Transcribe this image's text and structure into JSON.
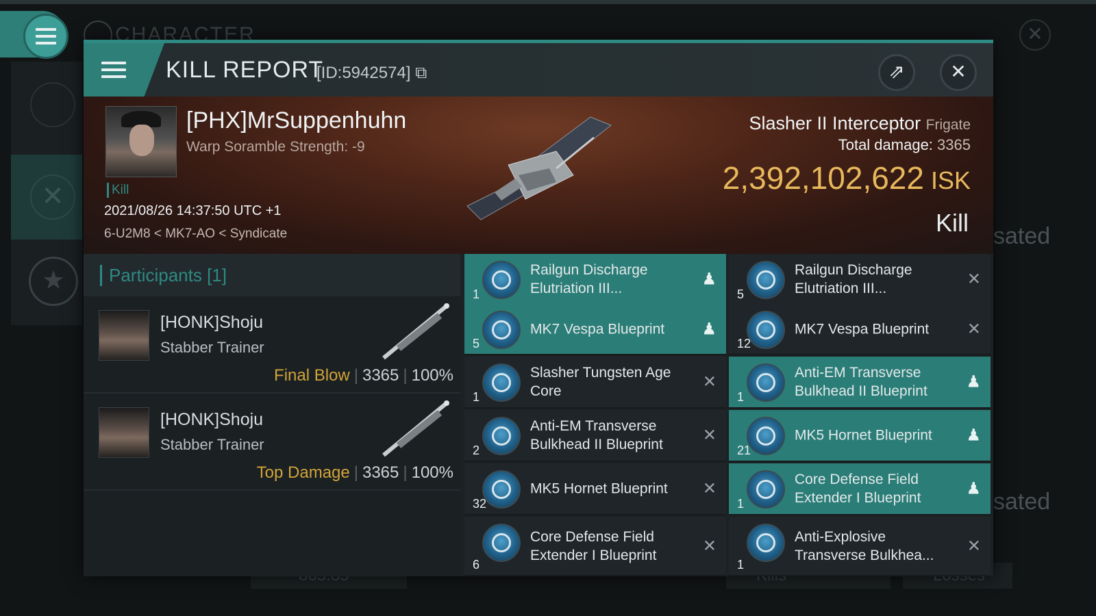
{
  "background": {
    "title": "CHARACTER",
    "sated_text_1": "sated",
    "sated_text_2": "sated",
    "bottom_value": "865.85",
    "bottom_kills": "Kills",
    "bottom_losses": "Losses"
  },
  "report": {
    "title": "KILL REPORT",
    "id": "[ID:5942574]",
    "victim_name": "[PHX]MrSuppenhuhn",
    "victim_sub": "Warp Soramble Strength: -9",
    "kill_tag": "Kill",
    "date": "2021/08/26 14:37:50 UTC +1",
    "location": "6-U2M8 < MK7-AO < Syndicate",
    "ship_name": "Slasher II Interceptor",
    "ship_class": "Frigate",
    "damage_label": "Total damage:",
    "damage_value": "3365",
    "isk_value": "2,392,102,622",
    "isk_unit": "ISK",
    "result": "Kill"
  },
  "participants": {
    "header": "Participants [1]",
    "rows": [
      {
        "name": "[HONK]Shoju",
        "ship": "Stabber Trainer",
        "role": "Final Blow",
        "damage": "3365",
        "percent": "100%"
      },
      {
        "name": "[HONK]Shoju",
        "ship": "Stabber Trainer",
        "role": "Top Damage",
        "damage": "3365",
        "percent": "100%"
      }
    ]
  },
  "items": [
    {
      "name": "Railgun Discharge Elutriation III...",
      "qty": "1",
      "dropped": true,
      "icon": "user-icon"
    },
    {
      "name": "Railgun Discharge Elutriation III...",
      "qty": "5",
      "dropped": false,
      "icon": "close-icon"
    },
    {
      "name": "MK7 Vespa Blueprint",
      "qty": "5",
      "dropped": true,
      "icon": "user-icon"
    },
    {
      "name": "MK7 Vespa Blueprint",
      "qty": "12",
      "dropped": false,
      "icon": "close-icon"
    },
    {
      "name": "Slasher Tungsten Age Core",
      "qty": "1",
      "dropped": false,
      "icon": "close-icon"
    },
    {
      "name": "Anti-EM Transverse Bulkhead II Blueprint",
      "qty": "1",
      "dropped": true,
      "icon": "user-icon"
    },
    {
      "name": "Anti-EM Transverse Bulkhead II Blueprint",
      "qty": "2",
      "dropped": false,
      "icon": "close-icon"
    },
    {
      "name": "MK5 Hornet Blueprint",
      "qty": "21",
      "dropped": true,
      "icon": "user-icon"
    },
    {
      "name": "MK5 Hornet Blueprint",
      "qty": "32",
      "dropped": false,
      "icon": "close-icon"
    },
    {
      "name": "Core Defense Field Extender I Blueprint",
      "qty": "1",
      "dropped": true,
      "icon": "user-icon"
    },
    {
      "name": "Core Defense Field Extender I Blueprint",
      "qty": "6",
      "dropped": false,
      "icon": "close-icon"
    },
    {
      "name": "Anti-Explosive Transverse Bulkhea...",
      "qty": "1",
      "dropped": false,
      "icon": "close-icon"
    }
  ],
  "colors": {
    "accent": "#2e8a83",
    "isk": "#e8b85c",
    "role": "#d2a43a"
  }
}
